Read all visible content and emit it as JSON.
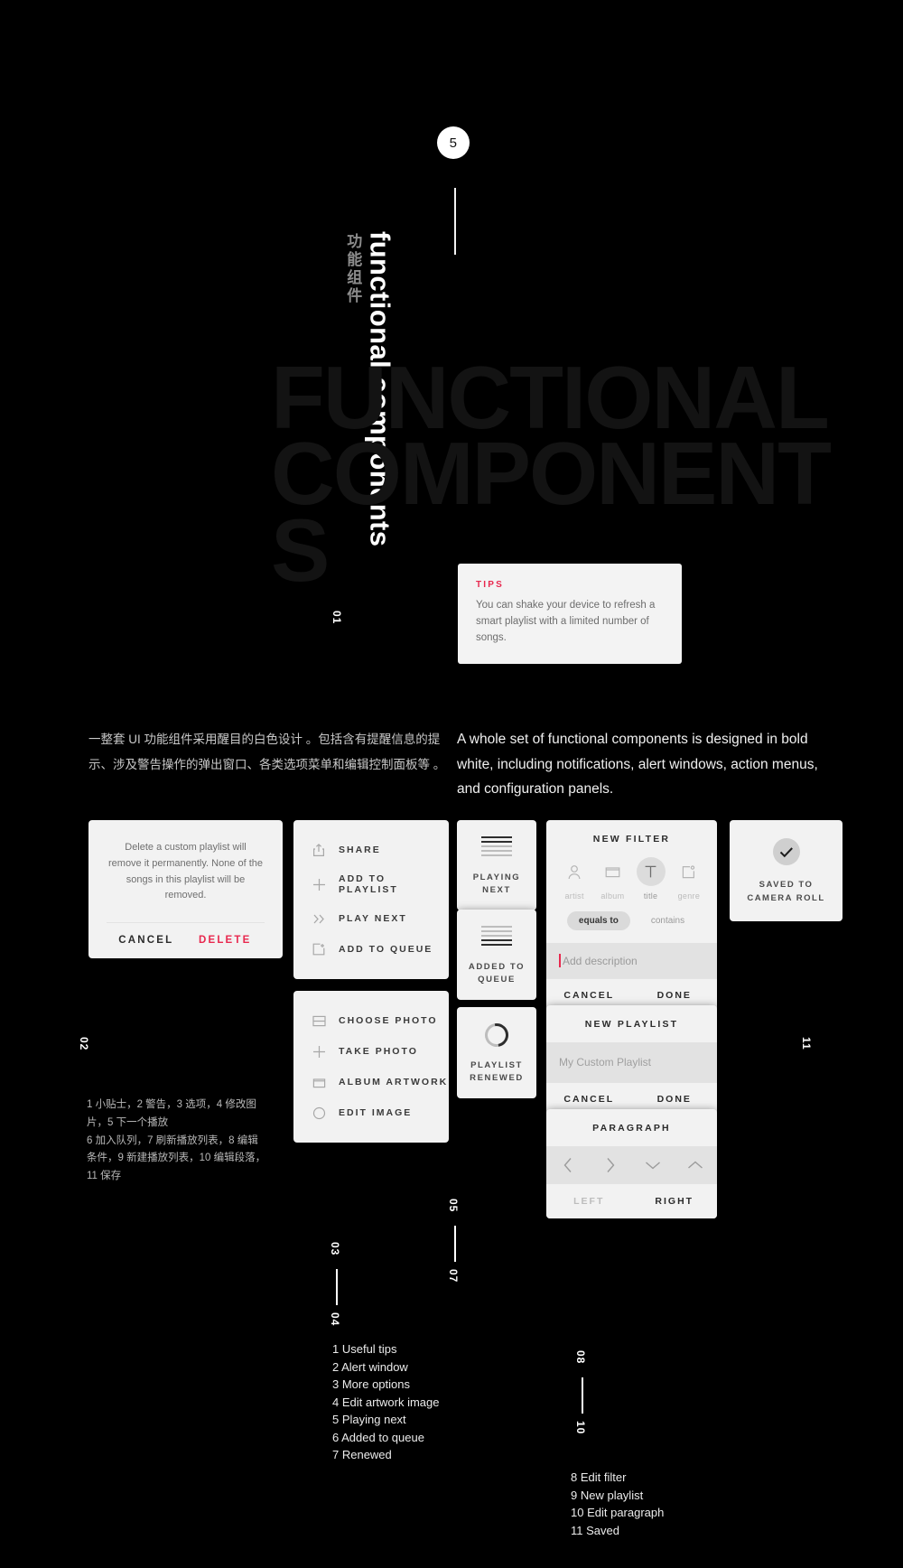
{
  "hero": {
    "section_number": "5",
    "title_cn": "功能组件",
    "title_en": "functional components",
    "ghost_text": "FUNCTIONAL COMPONENTS"
  },
  "tips": {
    "label": "TIPS",
    "body": "You can shake your device to refresh a smart playlist with a limited number of songs."
  },
  "description": {
    "cn": "一整套 UI 功能组件采用醒目的白色设计 。包括含有提醒信息的提示、涉及警告操作的弹出窗口、各类选项菜单和编辑控制面板等 。",
    "en": "A whole set of functional components is designed in bold white, including notifications, alert windows, action menus, and configuration panels."
  },
  "alert": {
    "message": "Delete a custom playlist will remove it permanently. None of the songs in this playlist will be removed.",
    "cancel": "CANCEL",
    "delete": "DELETE"
  },
  "share_menu": {
    "items": [
      {
        "label": "SHARE",
        "icon": "share-icon"
      },
      {
        "label": "ADD TO PLAYLIST",
        "icon": "plus-icon"
      },
      {
        "label": "PLAY NEXT",
        "icon": "double-chevron-right-icon"
      },
      {
        "label": "ADD TO QUEUE",
        "icon": "add-to-box-icon"
      }
    ]
  },
  "photo_menu": {
    "items": [
      {
        "label": "CHOOSE PHOTO",
        "icon": "split-rect-icon"
      },
      {
        "label": "TAKE PHOTO",
        "icon": "plus-icon"
      },
      {
        "label": "ALBUM ARTWORK",
        "icon": "album-icon"
      },
      {
        "label": "EDIT IMAGE",
        "icon": "circle-icon"
      }
    ]
  },
  "toasts": [
    {
      "label": "PLAYING NEXT",
      "icon": "queue-lines-top-icon"
    },
    {
      "label": "ADDED TO QUEUE",
      "icon": "queue-lines-bottom-icon"
    },
    {
      "label": "PLAYLIST RENEWED",
      "icon": "refresh-spinner-icon"
    }
  ],
  "saved": {
    "icon": "check-icon",
    "label": "SAVED TO CAMERA ROLL"
  },
  "new_filter": {
    "title": "NEW FILTER",
    "fields": [
      {
        "label": "artist",
        "icon": "person-icon",
        "active": false
      },
      {
        "label": "album",
        "icon": "album-icon",
        "active": false
      },
      {
        "label": "title",
        "icon": "text-t-icon",
        "active": true
      },
      {
        "label": "genre",
        "icon": "genre-tag-icon",
        "active": false
      }
    ],
    "operators": [
      {
        "label": "equals to",
        "selected": true
      },
      {
        "label": "contains",
        "selected": false
      }
    ],
    "input_placeholder": "Add description",
    "cancel": "CANCEL",
    "done": "DONE"
  },
  "new_playlist": {
    "title": "NEW PLAYLIST",
    "input_placeholder": "My Custom Playlist",
    "cancel": "CANCEL",
    "done": "DONE"
  },
  "paragraph": {
    "title": "PARAGRAPH",
    "nav_icons": [
      "chevron-left-icon",
      "chevron-right-icon",
      "chevron-down-icon",
      "chevron-up-icon"
    ],
    "align_left": "LEFT",
    "align_right": "RIGHT"
  },
  "markers": {
    "m01": "01",
    "m02": "02",
    "m03": "03",
    "m04": "04",
    "m05": "05",
    "m07": "07",
    "m08": "08",
    "m10": "10",
    "m11": "11"
  },
  "legend_cn": "1 小贴士，2 警告，3 选项，4 修改图片，5 下一个播放\n6 加入队列，7 刷新播放列表，8 编辑条件，9 新建播放列表，10 编辑段落，11 保存",
  "legend_en_1": [
    "1 Useful tips",
    "2 Alert window",
    "3 More options",
    "4 Edit artwork image",
    "5 Playing next",
    "6 Added to queue",
    "7 Renewed"
  ],
  "legend_en_2": [
    "8 Edit filter",
    "9 New playlist",
    "10 Edit paragraph",
    "11 Saved"
  ],
  "colors": {
    "background": "#000000",
    "card": "#f2f2f2",
    "accent": "#e8284e",
    "ghost": "#131313"
  }
}
